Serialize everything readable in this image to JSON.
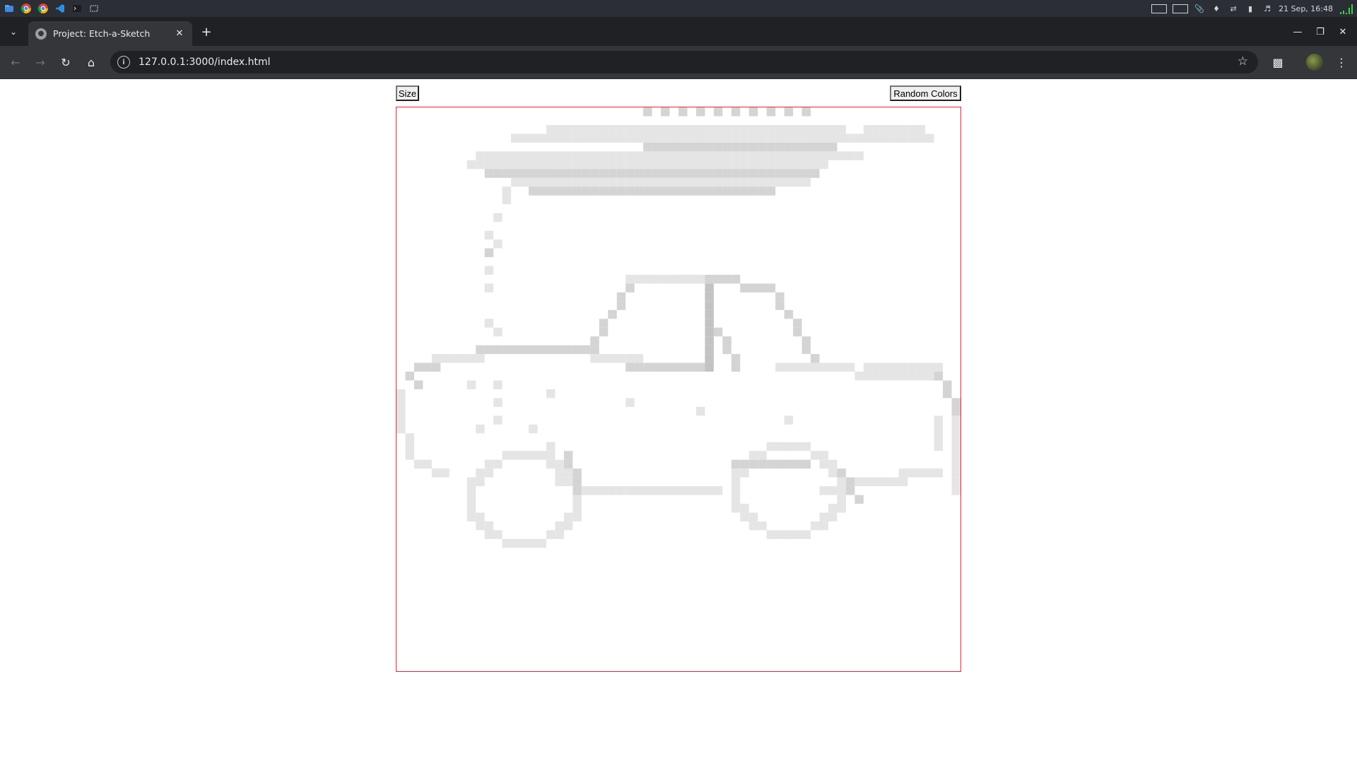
{
  "taskbar": {
    "apps": [
      "files-icon",
      "chrome-icon",
      "chrome-icon",
      "vscode-icon",
      "terminal-icon",
      "screenshot-icon"
    ],
    "tray_icons": [
      "attachment-icon",
      "bell-icon",
      "sync-icon",
      "battery-icon",
      "volume-icon"
    ],
    "datetime": "21 Sep, 16:48"
  },
  "browser": {
    "tab_title": "Project: Etch-a-Sketch",
    "url": "127.0.0.1:3000/index.html"
  },
  "page": {
    "size_button": "Size",
    "random_colors_button": "Random Colors",
    "grid_border_color": "#e8232e",
    "grid": {
      "cells_per_side": 64,
      "light_color": "#e5e5e5",
      "mid_color": "#d4d4d4",
      "dark_color": "#c3c3c3",
      "rows": [
        ".............................................................",
        ".................................mmm.m..m..m..mmm............",
        "................................................",
        "........................"
      ]
    }
  }
}
